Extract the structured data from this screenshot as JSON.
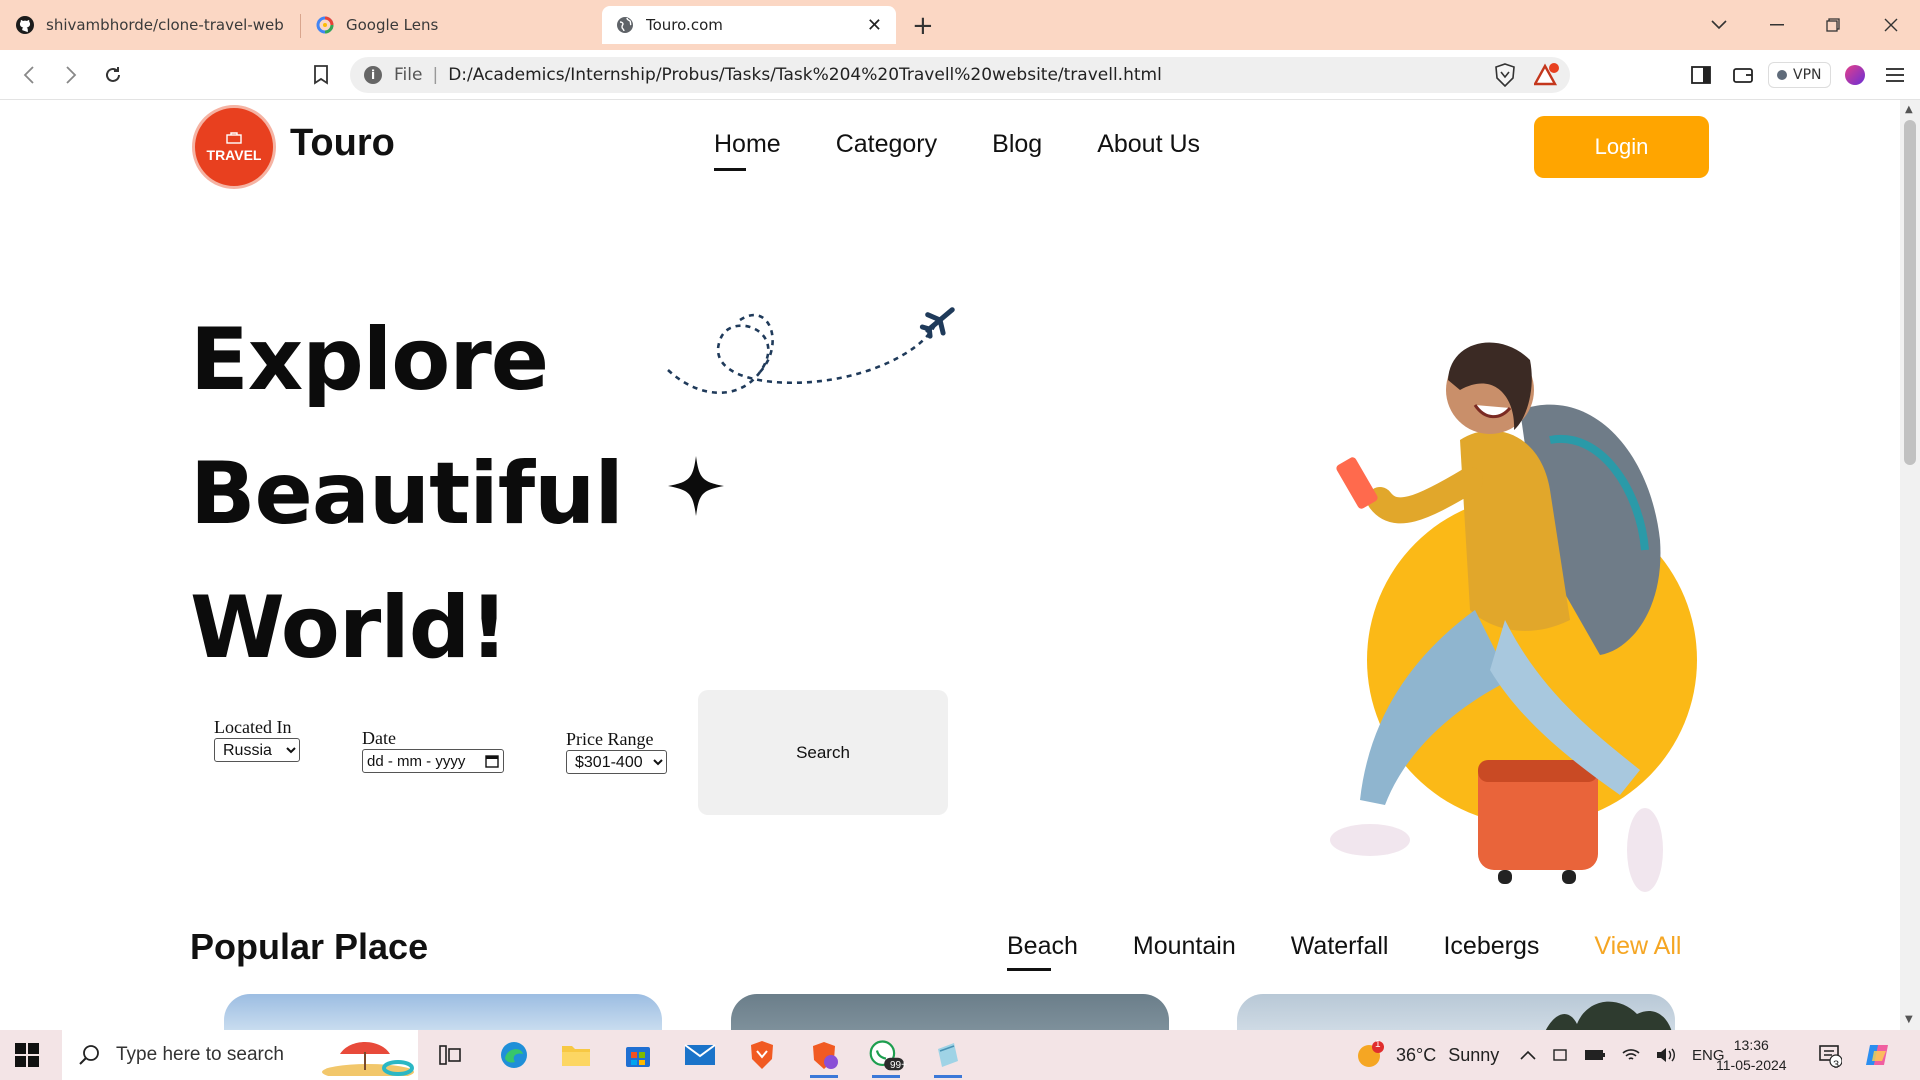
{
  "browser": {
    "tabs": [
      {
        "title": "shivambhorde/clone-travel-website:",
        "icon": "github-icon",
        "active": false
      },
      {
        "title": "Google Lens",
        "icon": "google-lens-icon",
        "active": false
      },
      {
        "title": "Touro.com",
        "icon": "globe-icon",
        "active": true
      }
    ],
    "address": {
      "scheme": "File",
      "url": "D:/Academics/Internship/Probus/Tasks/Task%204%20Travell%20website/travell.html"
    },
    "vpn_label": "VPN",
    "rewards_badge": "1"
  },
  "site": {
    "logo_text": "TRAVEL",
    "brand": "Touro",
    "nav": [
      {
        "label": "Home",
        "active": true
      },
      {
        "label": "Category",
        "active": false
      },
      {
        "label": "Blog",
        "active": false
      },
      {
        "label": "About Us",
        "active": false
      }
    ],
    "login_label": "Login",
    "accent_color": "#ffa500",
    "hero": {
      "lines": [
        "Explore",
        "Beautiful",
        "World!"
      ]
    },
    "search": {
      "location_label": "Located In",
      "location_value": "Russia",
      "date_label": "Date",
      "date_placeholder": "dd - mm - yyyy",
      "price_label": "Price Range",
      "price_value": "$301-400",
      "button_label": "Search"
    },
    "popular": {
      "title": "Popular Place",
      "filters": [
        {
          "label": "Beach",
          "active": true
        },
        {
          "label": "Mountain",
          "active": false
        },
        {
          "label": "Waterfall",
          "active": false
        },
        {
          "label": "Icebergs",
          "active": false
        },
        {
          "label": "View All",
          "active": false
        }
      ]
    }
  },
  "taskbar": {
    "search_placeholder": "Type here to search",
    "whatsapp_badge": "99+",
    "weather": {
      "temp": "36°C",
      "condition": "Sunny",
      "badge": "1"
    },
    "language": "ENG",
    "time": "13:36",
    "date": "11-05-2024",
    "notification_count": "3"
  }
}
